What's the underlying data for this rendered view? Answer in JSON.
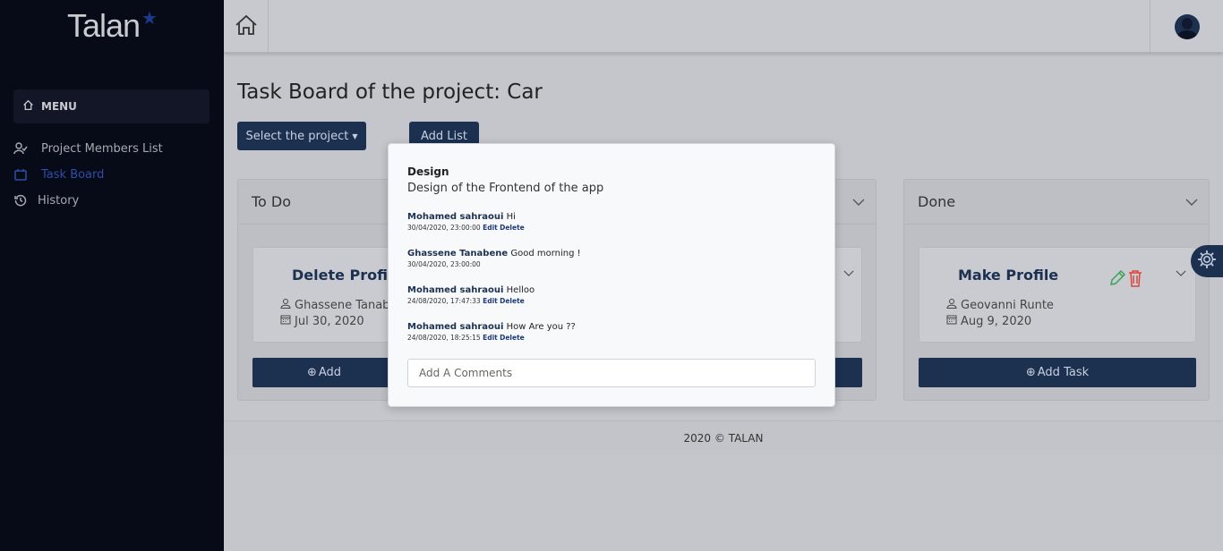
{
  "sidebar": {
    "logo": "Talan",
    "menu_label": "MENU",
    "items": [
      {
        "label": "Project Members List",
        "icon": "members-icon"
      },
      {
        "label": "Task Board",
        "icon": "board-icon",
        "active": true
      },
      {
        "label": "History",
        "icon": "history-icon"
      }
    ]
  },
  "topbar": {
    "home_icon": "home-icon",
    "avatar_icon": "user-avatar-icon"
  },
  "main": {
    "title": "Task Board of the project: Car",
    "select_project_label": "Select the project",
    "add_list_label": "Add List",
    "columns": [
      {
        "title": "To Do",
        "card": {
          "title": "Delete Profil",
          "assignee": "Ghassene Tanab",
          "date": "Jul 30, 2020"
        },
        "add_task_label": "Add"
      },
      {
        "title": "",
        "add_task_label": ""
      },
      {
        "title": "Done",
        "card": {
          "title": "Make Profile",
          "assignee": "Geovanni Runte",
          "date": "Aug 9, 2020"
        },
        "add_task_label": "Add Task"
      }
    ]
  },
  "footer": {
    "text": "2020 © TALAN"
  },
  "modal": {
    "title": "Design",
    "description": "Design of the Frontend of the app",
    "comments": [
      {
        "author": "Mohamed sahraoui",
        "text": "Hi",
        "time": "30/04/2020, 23:00:00",
        "edit": "Edit",
        "delete": "Delete"
      },
      {
        "author": "Ghassene Tanabene",
        "text": "Good morning !",
        "time": "30/04/2020, 23:00:00"
      },
      {
        "author": "Mohamed sahraoui",
        "text": "Helloo",
        "time": "24/08/2020, 17:47:33",
        "edit": "Edit",
        "delete": "Delete"
      },
      {
        "author": "Mohamed sahraoui",
        "text": "How Are you ??",
        "time": "24/08/2020, 18:25:15",
        "edit": "Edit",
        "delete": "Delete"
      }
    ],
    "input_placeholder": "Add A Comments"
  },
  "colors": {
    "sidebar_bg": "#070a17",
    "primary": "#1c3050",
    "active_link": "#2d4fa6",
    "edit_icon": "#3aa35a",
    "delete_icon": "#d9483b"
  }
}
